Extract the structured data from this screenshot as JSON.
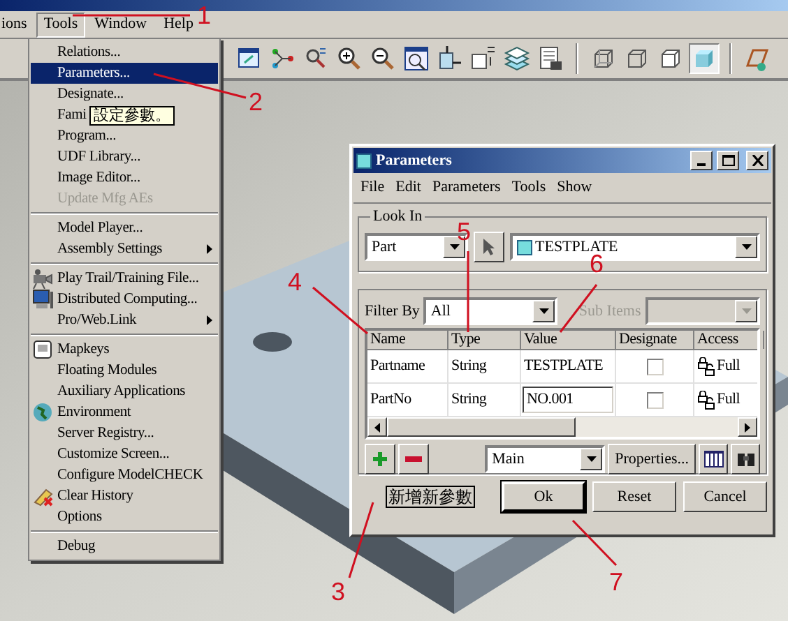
{
  "menubar": [
    {
      "label": "ions",
      "selected": false
    },
    {
      "label": "Tools",
      "selected": true
    },
    {
      "label": "Window",
      "selected": false
    },
    {
      "label": "Help",
      "selected": false
    }
  ],
  "toolbar": [
    {
      "selected": false
    },
    {
      "selected": false
    },
    {
      "selected": false
    },
    {
      "selected": false
    },
    {
      "selected": false
    },
    {
      "selected": false
    },
    {
      "selected": false
    },
    {
      "selected": false
    },
    {
      "selected": false
    },
    {
      "selected": false
    },
    {
      "selected": false
    },
    {
      "selected": false
    },
    {
      "selected": false
    },
    {
      "selected": true
    },
    {
      "selected": false
    }
  ],
  "tools_menu": [
    {
      "kind": "item",
      "label": "Relations...",
      "selected": false,
      "disabled": false,
      "submenu": false
    },
    {
      "kind": "item",
      "label": "Parameters...",
      "selected": true,
      "disabled": false,
      "submenu": false
    },
    {
      "kind": "item",
      "label": "Designate...",
      "selected": false,
      "disabled": false,
      "submenu": false
    },
    {
      "kind": "item",
      "label": "Fami",
      "selected": false,
      "disabled": false,
      "submenu": false
    },
    {
      "kind": "item",
      "label": "Program...",
      "selected": false,
      "disabled": false,
      "submenu": false
    },
    {
      "kind": "item",
      "label": "UDF Library...",
      "selected": false,
      "disabled": false,
      "submenu": false
    },
    {
      "kind": "item",
      "label": "Image Editor...",
      "selected": false,
      "disabled": false,
      "submenu": false
    },
    {
      "kind": "item",
      "label": "Update Mfg AEs",
      "selected": false,
      "disabled": true,
      "submenu": false
    },
    {
      "kind": "separator"
    },
    {
      "kind": "item",
      "label": "Model Player...",
      "selected": false,
      "disabled": false,
      "submenu": false
    },
    {
      "kind": "item",
      "label": "Assembly Settings",
      "selected": false,
      "disabled": false,
      "submenu": true
    },
    {
      "kind": "separator"
    },
    {
      "kind": "item",
      "label": "Play Trail/Training File...",
      "selected": false,
      "disabled": false,
      "submenu": false
    },
    {
      "kind": "item",
      "label": "Distributed Computing...",
      "selected": false,
      "disabled": false,
      "submenu": false
    },
    {
      "kind": "item",
      "label": "Pro/Web.Link",
      "selected": false,
      "disabled": false,
      "submenu": true
    },
    {
      "kind": "separator"
    },
    {
      "kind": "item",
      "label": "Mapkeys",
      "selected": false,
      "disabled": false,
      "submenu": false
    },
    {
      "kind": "item",
      "label": "Floating Modules",
      "selected": false,
      "disabled": false,
      "submenu": false
    },
    {
      "kind": "item",
      "label": "Auxiliary Applications",
      "selected": false,
      "disabled": false,
      "submenu": false
    },
    {
      "kind": "item",
      "label": "Environment",
      "selected": false,
      "disabled": false,
      "submenu": false
    },
    {
      "kind": "item",
      "label": "Server Registry...",
      "selected": false,
      "disabled": false,
      "submenu": false
    },
    {
      "kind": "item",
      "label": "Customize Screen...",
      "selected": false,
      "disabled": false,
      "submenu": false
    },
    {
      "kind": "item",
      "label": "Configure ModelCHECK",
      "selected": false,
      "disabled": false,
      "submenu": false
    },
    {
      "kind": "item",
      "label": "Clear History",
      "selected": false,
      "disabled": false,
      "submenu": false
    },
    {
      "kind": "item",
      "label": "Options",
      "selected": false,
      "disabled": false,
      "submenu": false
    },
    {
      "kind": "separator"
    },
    {
      "kind": "item",
      "label": "Debug",
      "selected": false,
      "disabled": false,
      "submenu": false
    }
  ],
  "tooltip": "設定參數。",
  "dialog": {
    "title": "Parameters",
    "menu": [
      "File",
      "Edit",
      "Parameters",
      "Tools",
      "Show"
    ],
    "look_in": {
      "label": "Look In",
      "type": "Part",
      "object": "TESTPLATE"
    },
    "filter": {
      "label": "Filter By",
      "value": "All",
      "sub_items_label": "Sub Items",
      "sub_items_disabled": true
    },
    "table": {
      "columns": [
        "Name",
        "Type",
        "Value",
        "Designate",
        "Access"
      ],
      "rows": [
        {
          "name": "Partname",
          "type": "String",
          "value": "TESTPLATE",
          "editing": false,
          "designate": false,
          "access": "Full"
        },
        {
          "name": "PartNo",
          "type": "String",
          "value": "NO.001",
          "editing": true,
          "designate": false,
          "access": "Full"
        }
      ]
    },
    "view": "Main",
    "properties": "Properties...",
    "status": "新增新參數",
    "buttons": [
      {
        "label": "Ok",
        "default": true
      },
      {
        "label": "Reset",
        "default": false
      },
      {
        "label": "Cancel",
        "default": false
      }
    ]
  },
  "annotations": [
    "1",
    "2",
    "3",
    "4",
    "5",
    "6",
    "7"
  ]
}
